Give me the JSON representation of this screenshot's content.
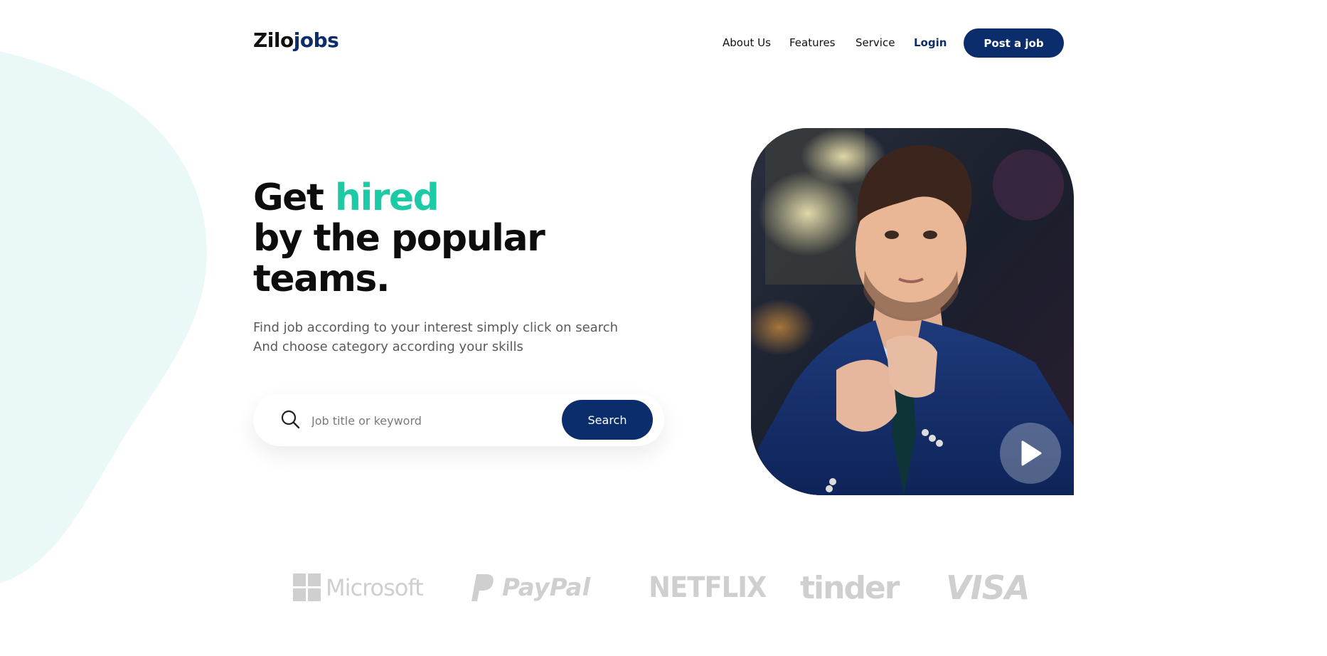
{
  "brand": {
    "name_part1": "Zilo",
    "name_part2": "jobs"
  },
  "nav": {
    "items": [
      {
        "label": "About Us"
      },
      {
        "label": "Features"
      },
      {
        "label": "Service"
      }
    ],
    "login_label": "Login",
    "post_job_label": "Post a job"
  },
  "hero": {
    "headline_part1": "Get ",
    "headline_accent": "hired",
    "headline_line2": "by the popular",
    "headline_line3": "teams.",
    "sub_line1": "Find job according to your interest simply click on search",
    "sub_line2": "And choose category according your skills"
  },
  "search": {
    "placeholder": "Job title or keyword",
    "button_label": "Search"
  },
  "media": {
    "play_icon": "play-icon"
  },
  "partners": [
    {
      "name": "Microsoft"
    },
    {
      "name": "PayPal"
    },
    {
      "name": "NETFLIX"
    },
    {
      "name": "tinder"
    },
    {
      "name": "VISA"
    }
  ],
  "colors": {
    "primary": "#0c2d6b",
    "accent": "#1ccba6",
    "blob": "#eaf8f7",
    "logo_gray": "#cfcfcf"
  }
}
